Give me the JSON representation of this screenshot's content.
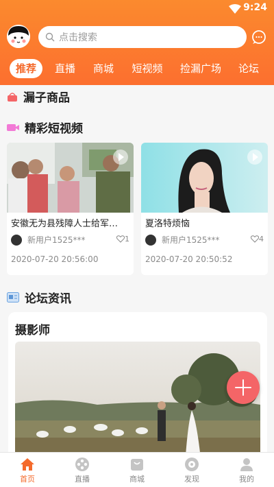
{
  "status": {
    "time": "9:24"
  },
  "search": {
    "placeholder": "点击搜索"
  },
  "tabs": [
    {
      "label": "推荐"
    },
    {
      "label": "直播"
    },
    {
      "label": "商城"
    },
    {
      "label": "短视频"
    },
    {
      "label": "捡漏广场"
    },
    {
      "label": "论坛"
    }
  ],
  "sections": {
    "leak_goods": "漏子商品",
    "short_video": "精彩短视频",
    "forum": "论坛资讯"
  },
  "videos": [
    {
      "title": "安徽无为县残障人士给军…",
      "user": "新用户1525***",
      "likes": "1",
      "time": "2020-07-20 20:56:00"
    },
    {
      "title": "夏洛特烦恼",
      "user": "新用户1525***",
      "likes": "4",
      "time": "2020-07-20 20:50:52"
    }
  ],
  "forum_post": {
    "title": "摄影师"
  },
  "bottom_nav": [
    {
      "label": "首页"
    },
    {
      "label": "直播"
    },
    {
      "label": "商城"
    },
    {
      "label": "发现"
    },
    {
      "label": "我的"
    }
  ],
  "colors": {
    "accent": "#f46a2b",
    "header": "#fb8a2e",
    "fab": "#f46567"
  }
}
